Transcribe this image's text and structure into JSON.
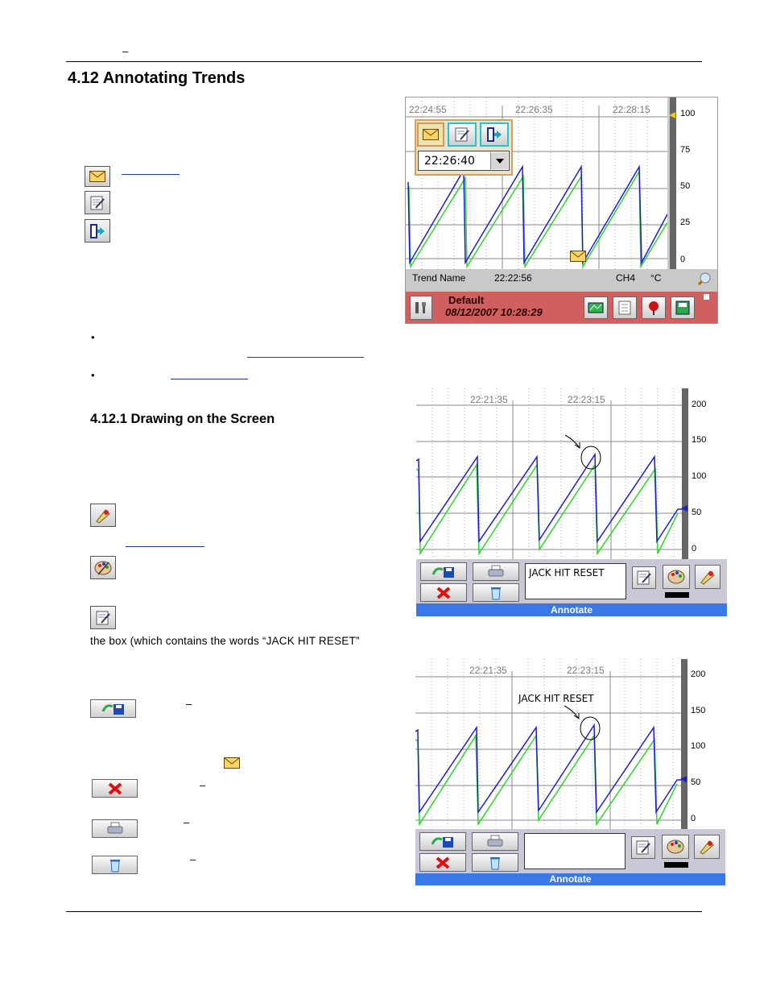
{
  "header": {
    "dash": "–"
  },
  "section": {
    "title": "4.12  Annotating Trends"
  },
  "subsection": {
    "title": "4.12.1  Drawing on the Screen"
  },
  "body": {
    "box_sentence": "the box (which contains the words “JACK HIT RESET”"
  },
  "button_dashes": {
    "save": "–",
    "cancel": "–",
    "print": "–",
    "clear": "–"
  },
  "screenshot1": {
    "times": [
      "22:24:55",
      "22:26:35",
      "22:28:15"
    ],
    "scale": [
      "100",
      "75",
      "50",
      "25",
      "0"
    ],
    "date_field": "22:26:40",
    "status": {
      "trend_name": "Trend Name",
      "time": "22:22:56",
      "channel": "CH4",
      "unit": "°C"
    },
    "footer": {
      "name": "Default",
      "datetime": "08/12/2007 10:28:29"
    }
  },
  "screenshot2": {
    "times": [
      "22:21:35",
      "22:23:15"
    ],
    "scale": [
      "200",
      "150",
      "100",
      "50",
      "0"
    ],
    "note_text": "JACK HIT RESET",
    "bar_title": "Annotate"
  },
  "screenshot3": {
    "times": [
      "22:21:35",
      "22:23:15"
    ],
    "scale": [
      "200",
      "150",
      "100",
      "50",
      "0"
    ],
    "chart_annotation": "JACK HIT RESET",
    "note_text": "",
    "bar_title": "Annotate"
  },
  "colors": {
    "trace_blue": "#1c1cd0",
    "trace_green": "#2bd62b",
    "footer_red": "#d06060",
    "annotate_bar": "#3b78e7"
  }
}
